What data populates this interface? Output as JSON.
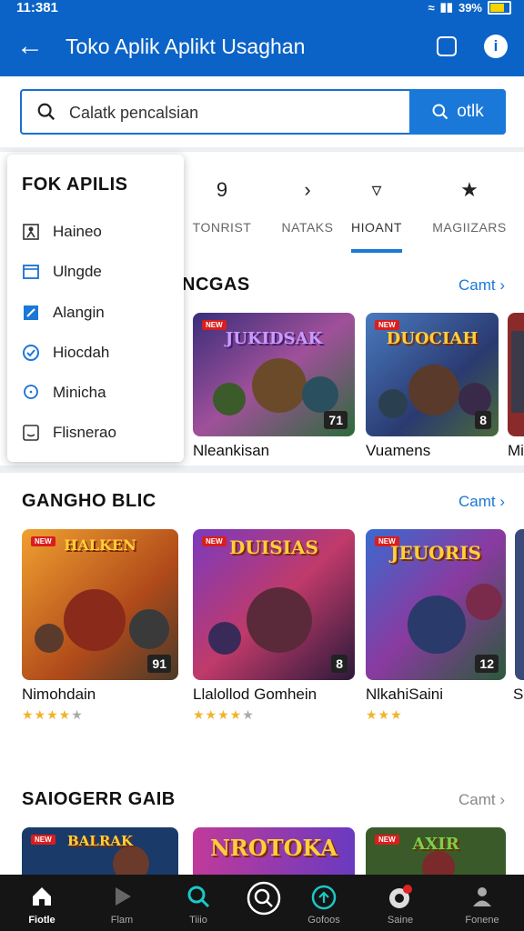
{
  "status_bar": {
    "time": "11:381",
    "battery": "39%"
  },
  "app_bar": {
    "title": "Toko Aplik Aplikt Usaghan"
  },
  "search": {
    "placeholder": "Calatk pencalsian",
    "button_label": "otlk"
  },
  "dropdown": {
    "title": "FOK APILIS",
    "items": [
      {
        "label": "Haineo",
        "icon": "user-icon"
      },
      {
        "label": "Ulngde",
        "icon": "window-icon"
      },
      {
        "label": "Alangin",
        "icon": "edit-icon"
      },
      {
        "label": "Hiocdah",
        "icon": "check-circle-icon"
      },
      {
        "label": "Minicha",
        "icon": "chat-icon"
      },
      {
        "label": "Flisnerao",
        "icon": "smile-box-icon"
      }
    ]
  },
  "tabs": [
    {
      "label": "TONRIST",
      "icon": "nine-icon"
    },
    {
      "label": "NATAKS",
      "icon": "chevron-right-icon"
    },
    {
      "label": "HIOANT",
      "icon": "pen-icon",
      "active": true
    },
    {
      "label": "MAGIIZARS",
      "icon": "star-icon"
    }
  ],
  "sections": [
    {
      "title": "NCGAS",
      "more": "Camt",
      "cards": [
        {
          "name": "Nleankisan",
          "logo": "JUKIDSAK",
          "badge": "NEW",
          "num": "71"
        },
        {
          "name": "Vuamens",
          "logo": "DUOCIAH",
          "badge": "NEW",
          "num": "8"
        },
        {
          "name": "Mi",
          "logo": "",
          "badge": "",
          "num": ""
        }
      ]
    },
    {
      "title": "GANGHO BLIC",
      "more": "Camt",
      "cards": [
        {
          "name": "Nimohdain",
          "logo": "HALKEN",
          "badge": "NEW",
          "num": "91",
          "stars": 4
        },
        {
          "name": "Llalollod Gomhein",
          "logo": "DUISIAS",
          "badge": "NEW",
          "num": "8",
          "stars": 4
        },
        {
          "name": "NlkahiSaini",
          "logo": "JEUORIS",
          "badge": "NEW",
          "num": "12",
          "stars": 3
        },
        {
          "name": "S",
          "logo": "",
          "badge": "",
          "num": ""
        }
      ]
    },
    {
      "title": "SAIOGERR  GAIB",
      "more": "Camt",
      "cards": [
        {
          "name": "",
          "logo": "BALRAK",
          "badge": "NEW",
          "num": ""
        },
        {
          "name": "",
          "logo": "NROTOKA",
          "badge": "",
          "num": ""
        },
        {
          "name": "",
          "logo": "AXIR",
          "badge": "NEW",
          "num": ""
        }
      ]
    }
  ],
  "bottom_nav": [
    {
      "label": "Fiotle",
      "icon": "home-icon",
      "active": true
    },
    {
      "label": "Flam",
      "icon": "play-icon"
    },
    {
      "label": "Tiiio",
      "icon": "search-icon"
    },
    {
      "label": "",
      "icon": "magnifier-circle-icon"
    },
    {
      "label": "Gofoos",
      "icon": "circle-arrow-icon"
    },
    {
      "label": "Saine",
      "icon": "notification-icon"
    },
    {
      "label": "Fonene",
      "icon": "profile-icon"
    }
  ],
  "colors": {
    "primary": "#0b63c7",
    "accent": "#1a78d8",
    "star": "#f0b429"
  }
}
